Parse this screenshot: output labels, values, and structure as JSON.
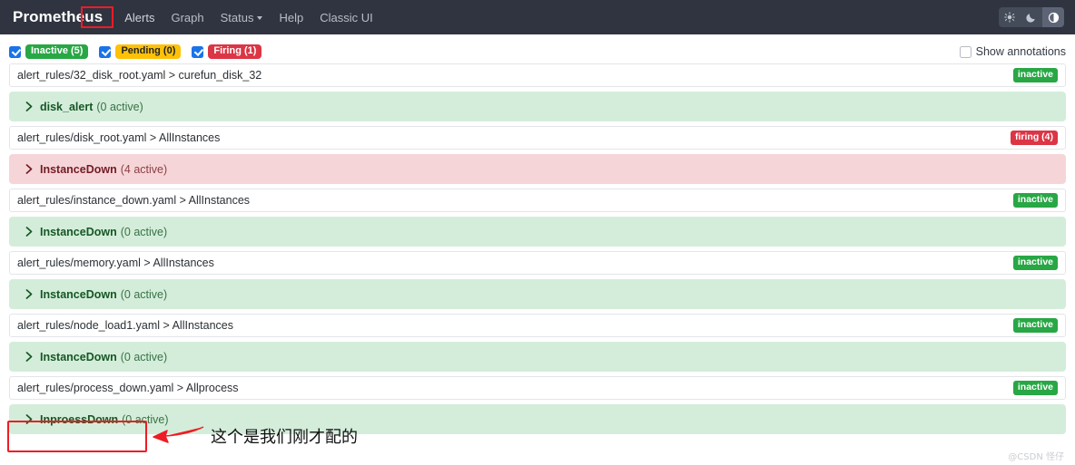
{
  "navbar": {
    "brand": "Prometheus",
    "links": [
      {
        "label": "Alerts",
        "name": "nav-link-alerts",
        "has_caret": false
      },
      {
        "label": "Graph",
        "name": "nav-link-graph",
        "has_caret": false
      },
      {
        "label": "Status",
        "name": "nav-link-status",
        "has_caret": true
      },
      {
        "label": "Help",
        "name": "nav-link-help",
        "has_caret": false
      },
      {
        "label": "Classic UI",
        "name": "nav-link-classic-ui",
        "has_caret": false
      }
    ],
    "theme": {
      "light_icon": "sun-icon",
      "dark_icon": "moon-icon",
      "auto_icon": "half-circle-icon",
      "selected": "auto"
    }
  },
  "filters": {
    "items": [
      {
        "label": "Inactive (5)",
        "color": "green",
        "checked": true
      },
      {
        "label": "Pending (0)",
        "color": "yellow",
        "checked": true
      },
      {
        "label": "Firing (1)",
        "color": "red",
        "checked": true
      }
    ],
    "show_annotations_label": "Show annotations",
    "show_annotations_checked": false
  },
  "groups": [
    {
      "file": "alert_rules/32_disk_root.yaml > curefun_disk_32",
      "state_badge": "inactive",
      "state_type": "inactive",
      "rule_name": "disk_alert",
      "rule_count": "(0 active)",
      "rule_state": "inactive",
      "chevron": "chevron-right-icon"
    },
    {
      "file": "alert_rules/disk_root.yaml > AllInstances",
      "state_badge": "firing (4)",
      "state_type": "firing",
      "rule_name": "InstanceDown",
      "rule_count": "(4 active)",
      "rule_state": "firing",
      "chevron": "chevron-right-icon"
    },
    {
      "file": "alert_rules/instance_down.yaml > AllInstances",
      "state_badge": "inactive",
      "state_type": "inactive",
      "rule_name": "InstanceDown",
      "rule_count": "(0 active)",
      "rule_state": "inactive",
      "chevron": "chevron-right-icon"
    },
    {
      "file": "alert_rules/memory.yaml > AllInstances",
      "state_badge": "inactive",
      "state_type": "inactive",
      "rule_name": "InstanceDown",
      "rule_count": "(0 active)",
      "rule_state": "inactive",
      "chevron": "chevron-right-icon"
    },
    {
      "file": "alert_rules/node_load1.yaml > AllInstances",
      "state_badge": "inactive",
      "state_type": "inactive",
      "rule_name": "InstanceDown",
      "rule_count": "(0 active)",
      "rule_state": "inactive",
      "chevron": "chevron-right-icon"
    },
    {
      "file": "alert_rules/process_down.yaml > Allprocess",
      "state_badge": "inactive",
      "state_type": "inactive",
      "rule_name": "InproessDown",
      "rule_count": "(0 active)",
      "rule_state": "inactive",
      "chevron": "chevron-right-icon"
    }
  ],
  "annotation": {
    "callout_text": "这个是我们刚才配的",
    "box_color": "#ee1c25",
    "arrow_icon": "left-arrow-icon"
  },
  "watermark": "@CSDN 怪仔"
}
